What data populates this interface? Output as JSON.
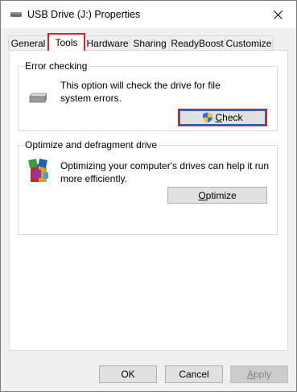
{
  "window": {
    "title": "USB Drive (J:) Properties",
    "title_icon": "usb-drive-icon",
    "close_icon": "close-icon"
  },
  "tabs": [
    {
      "label": "General"
    },
    {
      "label": "Tools",
      "active": true
    },
    {
      "label": "Hardware"
    },
    {
      "label": "Sharing"
    },
    {
      "label": "ReadyBoost"
    },
    {
      "label": "Customize"
    }
  ],
  "error_checking": {
    "group_label": "Error checking",
    "description_line1": "This option will check the drive for file",
    "description_line2": "system errors.",
    "button_mnemonic": "C",
    "button_rest": "heck",
    "icon": "drive-icon",
    "button_icon": "uac-shield-icon"
  },
  "optimize": {
    "group_label": "Optimize and defragment drive",
    "description_line1": "Optimizing your computer's drives can help it run",
    "description_line2": "more efficiently.",
    "button_mnemonic": "O",
    "button_rest": "ptimize",
    "icon": "defrag-icon"
  },
  "footer": {
    "ok_label": "OK",
    "cancel_label": "Cancel",
    "apply_mnemonic": "A",
    "apply_rest": "pply"
  },
  "colors": {
    "highlight": "#e02020",
    "focus": "#0078d7",
    "client_bg": "#f0f0f0"
  }
}
